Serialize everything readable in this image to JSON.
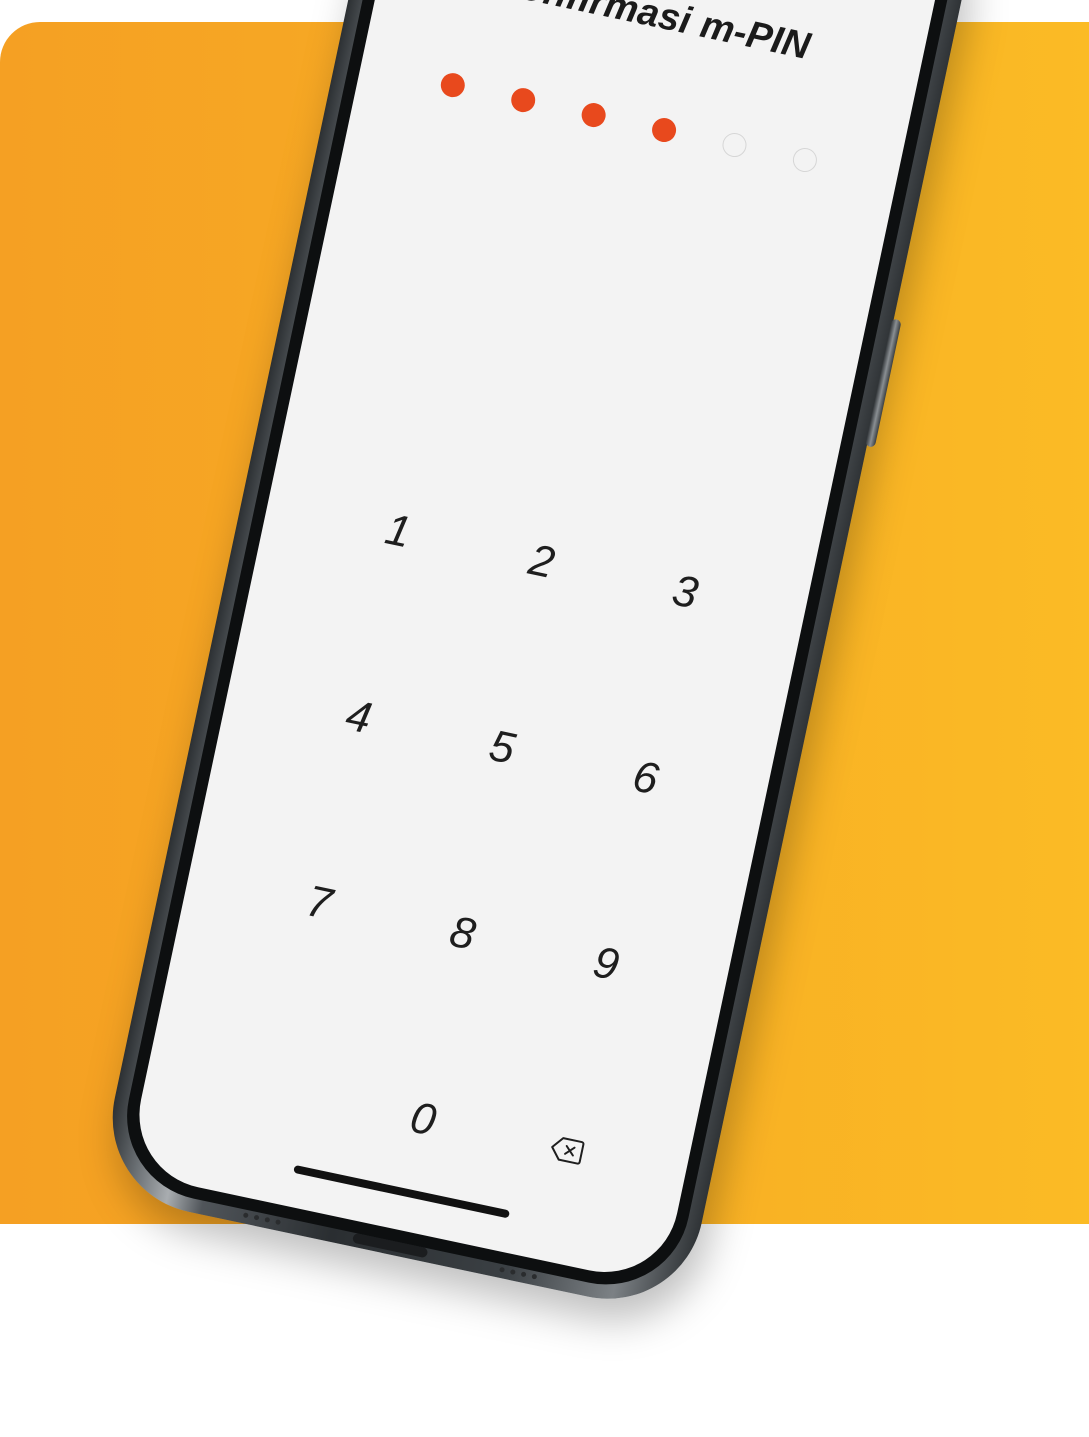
{
  "screen": {
    "title": "Konfirmasi m-PIN"
  },
  "pin": {
    "length": 6,
    "entered": 4,
    "filled_color": "#e8491d",
    "empty_color": "#d6d6d6"
  },
  "keypad": {
    "keys": [
      "1",
      "2",
      "3",
      "4",
      "5",
      "6",
      "7",
      "8",
      "9",
      "0"
    ],
    "backspace_icon": "backspace-icon"
  },
  "colors": {
    "backdrop_start": "#f5a023",
    "backdrop_end": "#fbbb25",
    "screen_bg": "#f3f3f3"
  }
}
